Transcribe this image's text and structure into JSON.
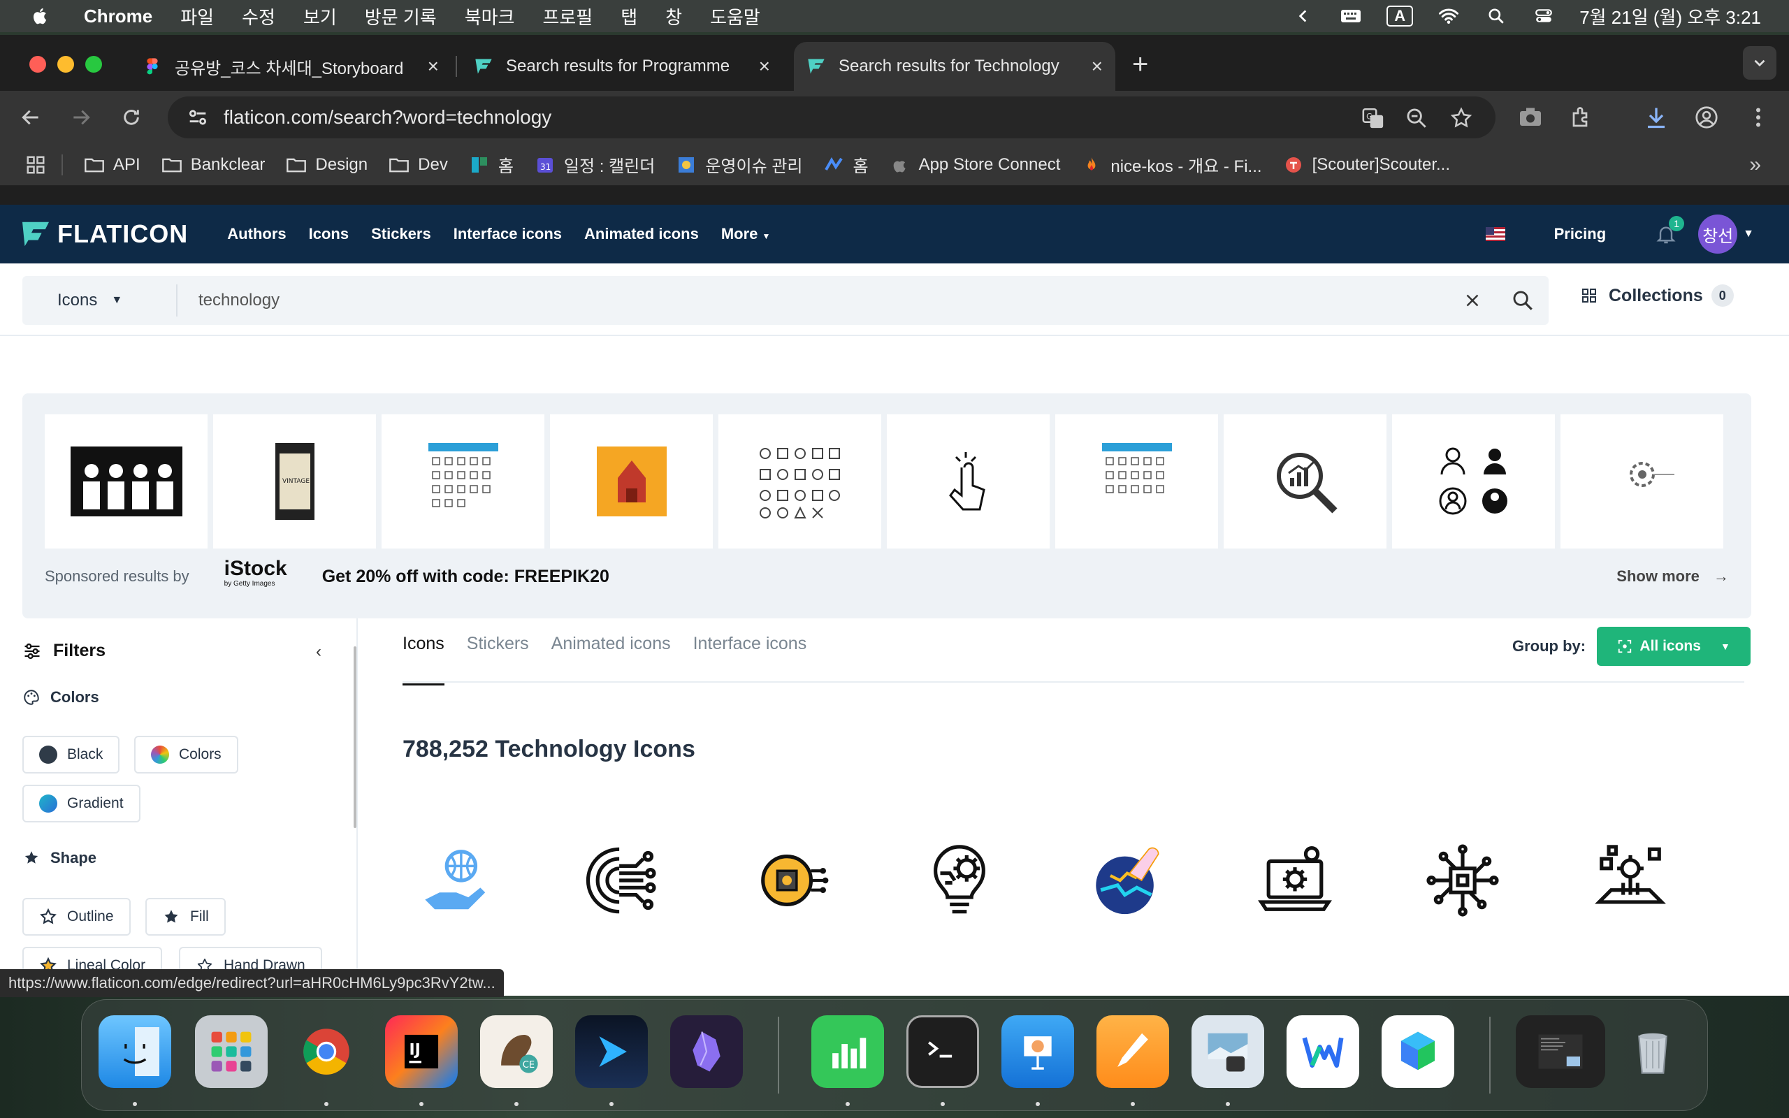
{
  "menubar": {
    "app": "Chrome",
    "items": [
      "파일",
      "수정",
      "보기",
      "방문 기록",
      "북마크",
      "프로필",
      "탭",
      "창",
      "도움말"
    ],
    "input_mode": "A",
    "clock": "7월 21일 (월) 오후 3:21"
  },
  "tabs": [
    {
      "label": "공유방_코스 차세대_Storyboard",
      "favicon": "figma-icon",
      "active": false
    },
    {
      "label": "Search results for Programme",
      "favicon": "flaticon-icon",
      "active": false
    },
    {
      "label": "Search results for Technology",
      "favicon": "flaticon-icon",
      "active": true
    }
  ],
  "toolbar": {
    "url": "flaticon.com/search?word=technology"
  },
  "bookmarks": [
    {
      "label": "API",
      "icon": "folder-icon"
    },
    {
      "label": "Bankclear",
      "icon": "folder-icon"
    },
    {
      "label": "Design",
      "icon": "folder-icon"
    },
    {
      "label": "Dev",
      "icon": "folder-icon"
    },
    {
      "label": "홈",
      "icon": "app-icon"
    },
    {
      "label": "일정 : 캘린더",
      "icon": "calendar-icon"
    },
    {
      "label": "운영이슈 관리",
      "icon": "app-icon"
    },
    {
      "label": "홈",
      "icon": "app-icon"
    },
    {
      "label": "App Store Connect",
      "icon": "apple-icon"
    },
    {
      "label": "nice-kos - 개요 - Fi...",
      "icon": "fire-icon"
    },
    {
      "label": "[Scouter]Scouter...",
      "icon": "app-icon"
    }
  ],
  "flaticon": {
    "logo": "FLATICON",
    "nav": [
      "Authors",
      "Icons",
      "Stickers",
      "Interface icons",
      "Animated icons",
      "More"
    ],
    "pricing": "Pricing",
    "notif_count": "1",
    "avatar": "창선",
    "search": {
      "category": "Icons",
      "query": "technology"
    },
    "collections_label": "Collections",
    "collections_count": "0",
    "sponsored": {
      "by": "Sponsored results by",
      "brand": "iStock",
      "brand_sub": "by Getty Images",
      "promo": "Get 20% off with code: FREEPIK20",
      "show_more": "Show more"
    },
    "filters": {
      "title": "Filters",
      "colors_title": "Colors",
      "colors": [
        "Black",
        "Colors",
        "Gradient"
      ],
      "shape_title": "Shape",
      "shapes": [
        "Outline",
        "Fill",
        "Lineal Color",
        "Hand Drawn"
      ]
    },
    "type_tabs": [
      "Icons",
      "Stickers",
      "Animated icons",
      "Interface icons"
    ],
    "group_by_label": "Group by:",
    "group_by_value": "All icons",
    "result_title": "788,252 Technology Icons"
  },
  "status_url": "https://www.flaticon.com/edge/redirect?url=aHR0cHM6Ly9pc3RvY2tw...",
  "dock": [
    "Finder",
    "Launchpad",
    "Chrome",
    "IntelliJ IDEA",
    "DBeaver",
    "Cursor",
    "Obsidian",
    "Numbers",
    "Terminal",
    "Keynote",
    "Pages",
    "Preview",
    "Naver Whale",
    "Naver Works",
    "Trash"
  ],
  "colors": {
    "nav_bg": "#0e2a47",
    "accent_green": "#1fb57a",
    "avatar": "#7a55d6"
  }
}
